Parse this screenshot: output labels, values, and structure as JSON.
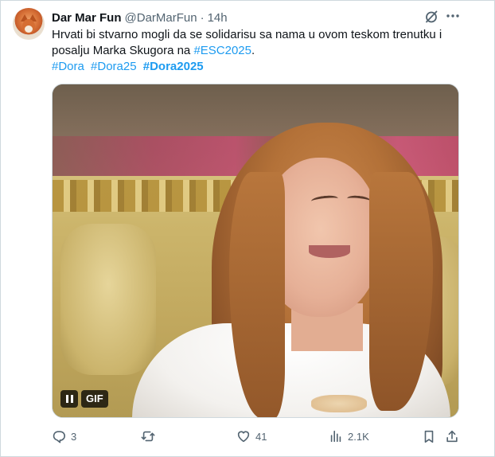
{
  "author": {
    "display_name": "Dar Mar Fun",
    "handle": "@DarMarFun",
    "separator": "·",
    "time": "14h"
  },
  "tweet": {
    "text_before_link": "Hrvati bi stvarno mogli da se solidarisu sa nama u ovom teskom trenutku i posalju Marka Skugora na ",
    "link_tag": "#ESC2025",
    "text_after_link": ".",
    "hashtags": [
      "#Dora",
      "#Dora25",
      "#Dora2025"
    ]
  },
  "media": {
    "gif_label": "GIF"
  },
  "actions": {
    "reply_count": "3",
    "retweet_count": "",
    "like_count": "41",
    "views_count": "2.1K"
  },
  "colors": {
    "link": "#1d9bf0",
    "text": "#0f1419",
    "secondary": "#536471",
    "border": "#cfd9de"
  }
}
